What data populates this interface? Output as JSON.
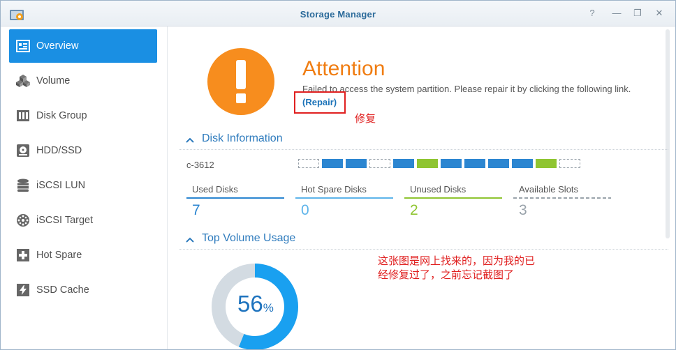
{
  "window": {
    "title": "Storage Manager"
  },
  "titlebar_buttons": [
    {
      "name": "help-button",
      "glyph": "?"
    },
    {
      "name": "minimize-button",
      "glyph": "—"
    },
    {
      "name": "maximize-button",
      "glyph": "❐"
    },
    {
      "name": "close-button",
      "glyph": "✕"
    }
  ],
  "sidebar": {
    "items": [
      {
        "label": "Overview",
        "icon": "overview-icon",
        "active": true
      },
      {
        "label": "Volume",
        "icon": "cubes-icon"
      },
      {
        "label": "Disk Group",
        "icon": "disk-group-icon"
      },
      {
        "label": "HDD/SSD",
        "icon": "hdd-icon"
      },
      {
        "label": "iSCSI LUN",
        "icon": "database-icon"
      },
      {
        "label": "iSCSI Target",
        "icon": "target-icon"
      },
      {
        "label": "Hot Spare",
        "icon": "plus-box-icon"
      },
      {
        "label": "SSD Cache",
        "icon": "lightning-icon"
      }
    ]
  },
  "alert": {
    "title": "Attention",
    "message": "Failed to access the system partition. Please repair it by clicking the following link.",
    "repair_link": "(Repair)",
    "annotation": "修复",
    "color": "#f78d1e"
  },
  "disk_info": {
    "section_title": "Disk Information",
    "device": "c-3612",
    "slots": [
      "empty",
      "used",
      "used",
      "empty",
      "used",
      "spare",
      "used",
      "used",
      "used",
      "used",
      "spare",
      "empty"
    ],
    "stats": [
      {
        "label": "Used Disks",
        "value": "7",
        "color": "#2c86d1"
      },
      {
        "label": "Hot Spare Disks",
        "value": "0",
        "color": "#5eb4ea"
      },
      {
        "label": "Unused Disks",
        "value": "2",
        "color": "#8fc532"
      },
      {
        "label": "Available Slots",
        "value": "3",
        "color": "#9aa3ab"
      }
    ]
  },
  "volume_usage": {
    "section_title": "Top Volume Usage",
    "percent": 56,
    "percent_text": "56",
    "unit": "%"
  },
  "annotation_note": {
    "line1": "这张图是网上找来的，因为我的已",
    "line2": "经修复过了，之前忘记截图了"
  }
}
